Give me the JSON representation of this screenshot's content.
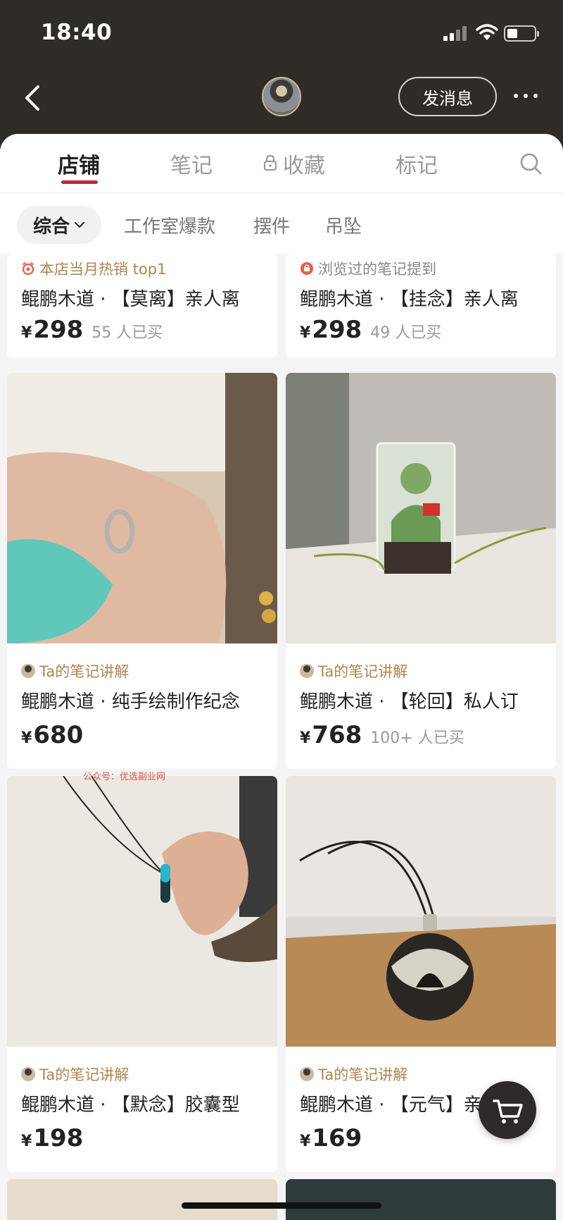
{
  "status_bar": {
    "time": "18:40"
  },
  "header": {
    "message_button": "发消息"
  },
  "tabs": [
    {
      "label": "店铺"
    },
    {
      "label": "笔记"
    },
    {
      "label": "收藏"
    },
    {
      "label": "标记"
    }
  ],
  "filters": [
    {
      "label": "综合"
    },
    {
      "label": "工作室爆款"
    },
    {
      "label": "摆件"
    },
    {
      "label": "吊坠"
    }
  ],
  "products": [
    {
      "tag": "本店当月热销 top1",
      "title": "鲲鹏木道 · 【莫离】亲人离",
      "currency": "¥",
      "price": "298",
      "sold": "55 人已买"
    },
    {
      "tag": "浏览过的笔记提到",
      "title": "鲲鹏木道 · 【挂念】亲人离",
      "currency": "¥",
      "price": "298",
      "sold": "49 人已买"
    },
    {
      "tag": "Ta的笔记讲解",
      "title": "鲲鹏木道 · 纯手绘制作纪念",
      "currency": "¥",
      "price": "680",
      "sold": ""
    },
    {
      "tag": "Ta的笔记讲解",
      "title": "鲲鹏木道 · 【轮回】私人订",
      "currency": "¥",
      "price": "768",
      "sold": "100+ 人已买"
    },
    {
      "tag": "Ta的笔记讲解",
      "title": "鲲鹏木道 · 【默念】胶囊型",
      "currency": "¥",
      "price": "198",
      "sold": ""
    },
    {
      "tag": "Ta的笔记讲解",
      "title": "鲲鹏木道 · 【元气】亲人离",
      "currency": "¥",
      "price": "169",
      "sold": ""
    }
  ],
  "watermark": "公众号：优选副业网",
  "colors": {
    "header_bg": "#2f2b27",
    "accent": "#c9213a",
    "tag_gold": "#b0854f",
    "tag_red": "#e8604c"
  },
  "icons": [
    "back-icon",
    "more-icon",
    "lock-icon",
    "search-icon",
    "chevron-down-icon",
    "alarm-icon",
    "cart-icon"
  ]
}
